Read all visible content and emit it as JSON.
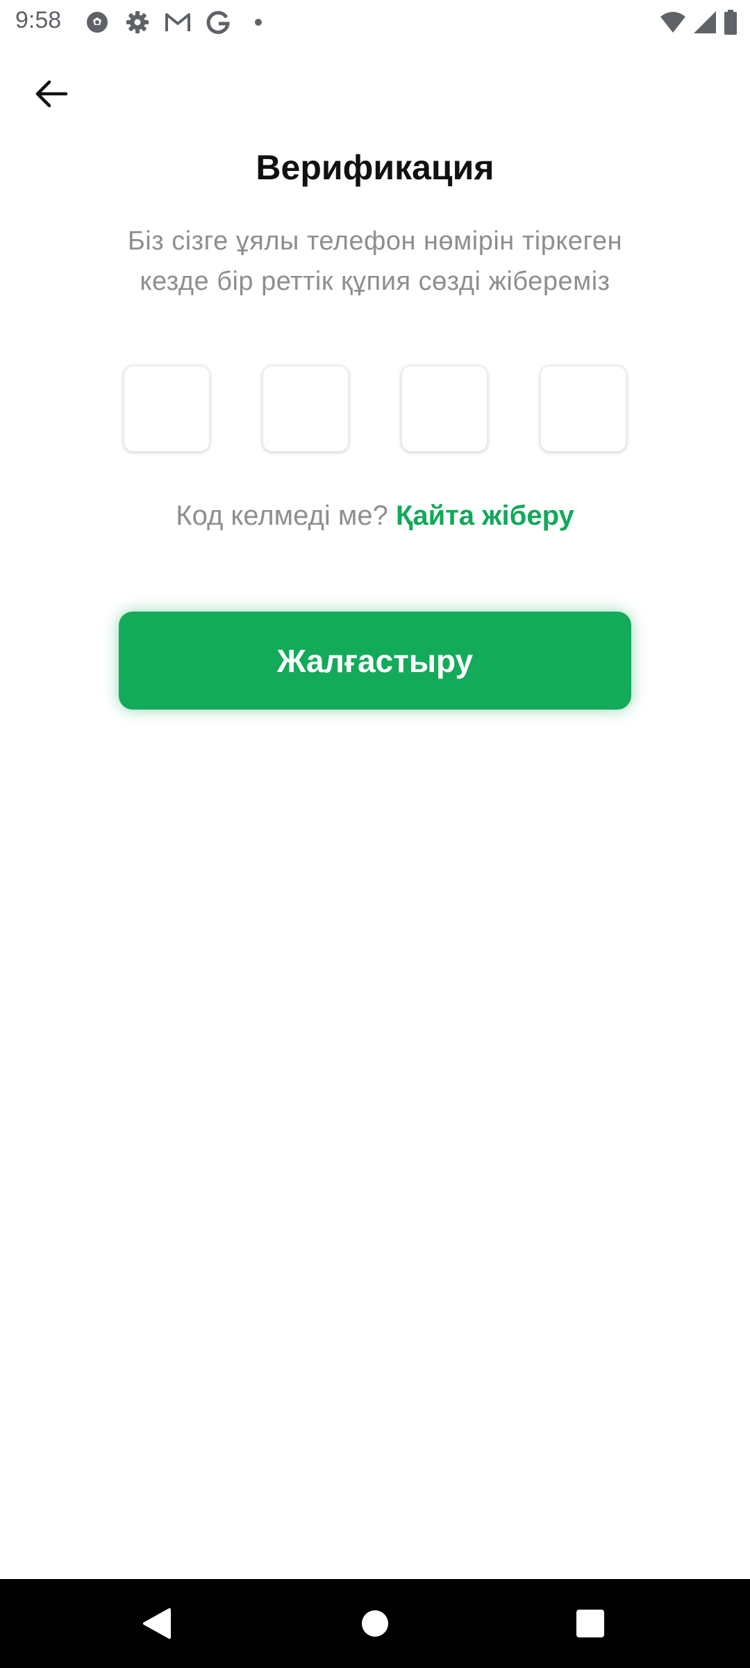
{
  "status_bar": {
    "time": "9:58",
    "left_icons": [
      "soccer-ball-icon",
      "settings-gear-icon",
      "gmail-icon",
      "google-icon",
      "notification-dot-icon"
    ],
    "right_icons": [
      "wifi-icon",
      "cellular-signal-icon",
      "battery-icon"
    ]
  },
  "header": {
    "back_icon": "arrow-back-icon"
  },
  "main": {
    "title": "Верификация",
    "subtitle_line1": "Біз сізге ұялы телефон нөмірін тіркеген",
    "subtitle_line2": "кезде бір реттік құпия сөзді жібереміз",
    "otp_fields": [
      "",
      "",
      "",
      ""
    ],
    "resend_question": "Код келмеді ме?",
    "resend_link": "Қайта жіберу",
    "continue_label": "Жалғастыру"
  },
  "colors": {
    "accent": "#13aa5a",
    "muted_text": "#8e8e8e",
    "title_text": "#111111",
    "nav_bar": "#000000"
  },
  "nav_bar": {
    "buttons": [
      "back-triangle-icon",
      "home-circle-icon",
      "recents-square-icon"
    ]
  }
}
